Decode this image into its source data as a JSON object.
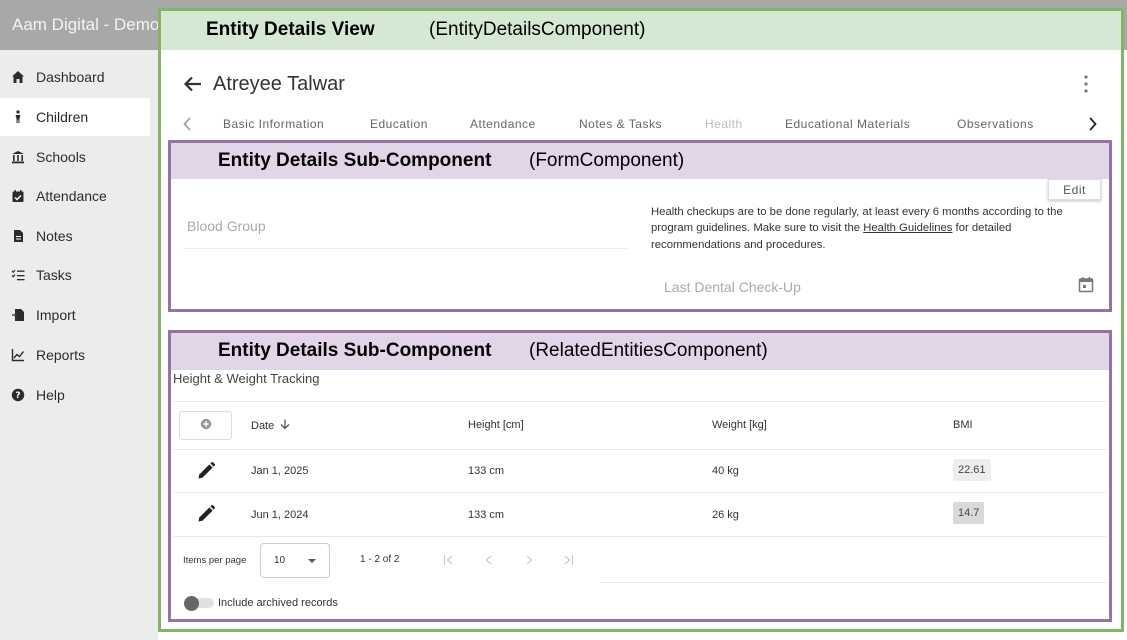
{
  "app": {
    "title": "Aam Digital - Demo"
  },
  "sidebar": {
    "items": [
      {
        "label": "Dashboard",
        "icon": "home-icon",
        "active": false
      },
      {
        "label": "Children",
        "icon": "child-icon",
        "active": true
      },
      {
        "label": "Schools",
        "icon": "school-building-icon",
        "active": false
      },
      {
        "label": "Attendance",
        "icon": "calendar-check-icon",
        "active": false
      },
      {
        "label": "Notes",
        "icon": "file-icon",
        "active": false
      },
      {
        "label": "Tasks",
        "icon": "task-list-icon",
        "active": false
      },
      {
        "label": "Import",
        "icon": "file-import-icon",
        "active": false
      },
      {
        "label": "Reports",
        "icon": "line-chart-icon",
        "active": false
      },
      {
        "label": "Help",
        "icon": "help-circle-icon",
        "active": false
      }
    ]
  },
  "annotations": {
    "entity_details": {
      "title": "Entity Details View",
      "component": "(EntityDetailsComponent)"
    },
    "form": {
      "title": "Entity Details Sub-Component",
      "component": "(FormComponent)"
    },
    "related": {
      "title": "Entity Details Sub-Component",
      "component": "(RelatedEntitiesComponent)"
    }
  },
  "entity": {
    "name": "Atreyee Talwar"
  },
  "tabs": [
    {
      "label": "Basic Information",
      "disabled": false
    },
    {
      "label": "Education",
      "disabled": false
    },
    {
      "label": "Attendance",
      "disabled": false
    },
    {
      "label": "Notes & Tasks",
      "disabled": false
    },
    {
      "label": "Health",
      "disabled": true
    },
    {
      "label": "Educational Materials",
      "disabled": false
    },
    {
      "label": "Observations",
      "disabled": false
    }
  ],
  "form": {
    "edit_label": "Edit",
    "blood_group_label": "Blood Group",
    "health_info_before": "Health checkups are to be done regularly, at least every 6 months according to the program guidelines. Make sure to visit the ",
    "health_info_link": "Health Guidelines",
    "health_info_after": " for detailed recommendations and procedures.",
    "dental_label": "Last Dental Check-Up"
  },
  "tracking": {
    "title": "Height & Weight Tracking",
    "columns": {
      "date": "Date",
      "height": "Height [cm]",
      "weight": "Weight [kg]",
      "bmi": "BMI"
    },
    "rows": [
      {
        "date": "Jan 1, 2025",
        "height": "133 cm",
        "weight": "40 kg",
        "bmi": "22.61",
        "bmi_color": "#ededed"
      },
      {
        "date": "Jun 1, 2024",
        "height": "133 cm",
        "weight": "26 kg",
        "bmi": "14.7",
        "bmi_color": "#d9d9d9"
      }
    ]
  },
  "paginator": {
    "items_per_page_label": "Items per page",
    "page_size": "10",
    "range": "1 - 2 of 2"
  },
  "archived_toggle": {
    "label": "Include archived records",
    "checked": false
  },
  "colors": {
    "annotation_green": "#86b36a",
    "annotation_green_fill": "#d5e8d4",
    "annotation_purple": "#9673a6",
    "annotation_purple_fill": "#e1d5e7"
  }
}
